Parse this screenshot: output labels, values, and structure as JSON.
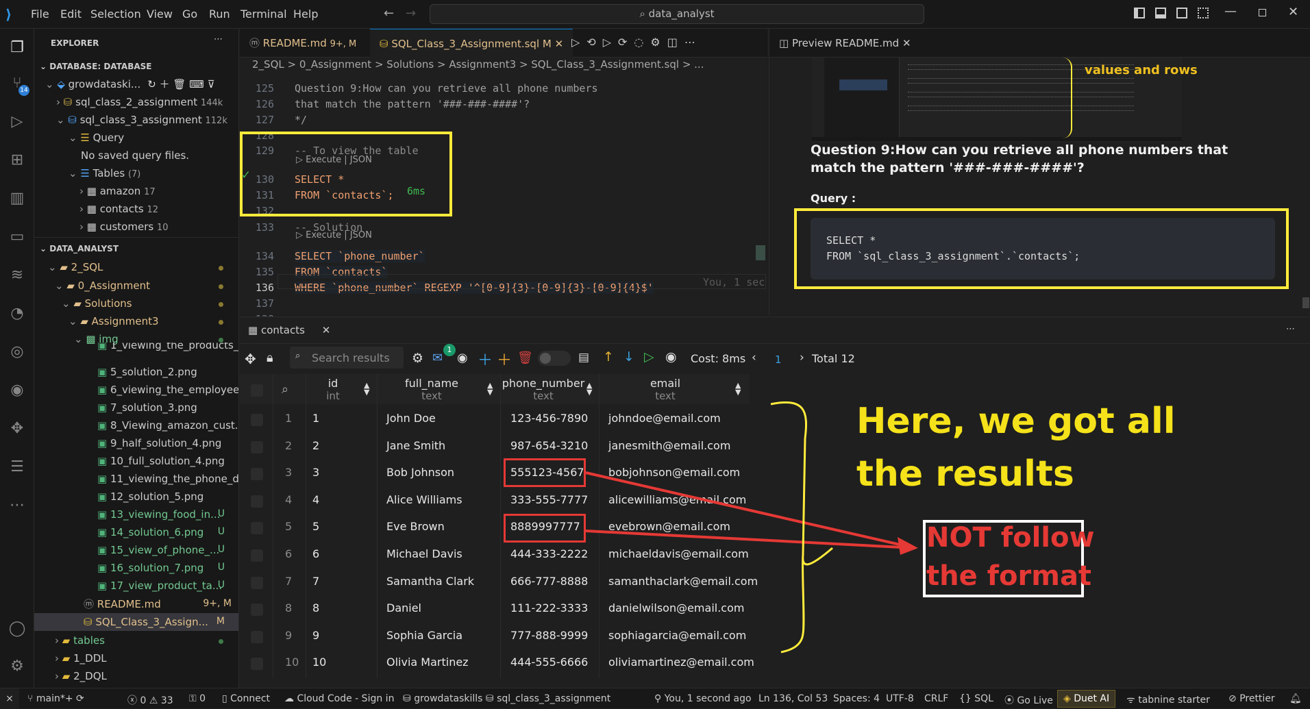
{
  "window": {
    "search": "data_analyst"
  },
  "menu": [
    "File",
    "Edit",
    "Selection",
    "View",
    "Go",
    "Run",
    "Terminal",
    "Help"
  ],
  "explorer": {
    "title": "EXPLORER",
    "db_section": "DATABASE: DATABASE",
    "db_root": "growdataski...",
    "db_items": [
      {
        "name": "sql_class_2_assignment",
        "size": "144k"
      },
      {
        "name": "sql_class_3_assignment",
        "size": "112k"
      }
    ],
    "query": "Query",
    "no_saved": "No saved query files.",
    "tables_label": "Tables",
    "tables_count": "(7)",
    "tables": [
      {
        "name": "amazon",
        "count": "17"
      },
      {
        "name": "contacts",
        "count": "12"
      },
      {
        "name": "customers",
        "count": "10"
      }
    ],
    "project_section": "DATA_ANALYST",
    "tree": [
      "2_SQL",
      "0_Assignment",
      "Solutions",
      "Assignment3",
      "img"
    ],
    "files": [
      {
        "name": "1_viewing_the_products_...",
        "st": ""
      },
      {
        "name": "5_solution_2.png",
        "st": ""
      },
      {
        "name": "6_viewing_the_employee...",
        "st": ""
      },
      {
        "name": "7_solution_3.png",
        "st": ""
      },
      {
        "name": "8_Viewing_amazon_cust...",
        "st": ""
      },
      {
        "name": "9_half_solution_4.png",
        "st": ""
      },
      {
        "name": "10_full_solution_4.png",
        "st": ""
      },
      {
        "name": "11_viewing_the_phone_d...",
        "st": ""
      },
      {
        "name": "12_solution_5.png",
        "st": ""
      },
      {
        "name": "13_viewing_food_in...",
        "st": "U"
      },
      {
        "name": "14_solution_6.png",
        "st": "U"
      },
      {
        "name": "15_view_of_phone_...",
        "st": "U"
      },
      {
        "name": "16_solution_7.png",
        "st": "U"
      },
      {
        "name": "17_view_product_ta...",
        "st": "U"
      }
    ],
    "readme": "README.md",
    "readme_badge": "9+, M",
    "sqlfile": "SQL_Class_3_Assign...",
    "sqlfile_badge": "M",
    "after": [
      "tables",
      "1_DDL",
      "2_DQL"
    ]
  },
  "editor": {
    "tab1": "README.md",
    "tab1_badge": "9+, M",
    "tab2": "SQL_Class_3_Assignment.sql",
    "tab2_badge": "M",
    "breadcrumb": "2_SQL > 0_Assignment > Solutions > Assignment3 > SQL_Class_3_Assignment.sql > ...",
    "lens": "Execute | JSON",
    "lines": [
      {
        "n": "125",
        "t": "Question 9:How can you retrieve all phone numbers"
      },
      {
        "n": "126",
        "t": "that match the pattern '###-###-####'?"
      },
      {
        "n": "127",
        "t": "*/"
      },
      {
        "n": "128",
        "t": ""
      },
      {
        "n": "129",
        "t": "-- To view the table"
      },
      {
        "n": "130",
        "t": "SELECT *"
      },
      {
        "n": "131",
        "t": "FROM `contacts`;"
      },
      {
        "n": "132",
        "t": ""
      },
      {
        "n": "133",
        "t": "-- Solution"
      },
      {
        "n": "134",
        "t": "SELECT `phone_number`"
      },
      {
        "n": "135",
        "t": "FROM `contacts`"
      },
      {
        "n": "136",
        "t": "WHERE `phone_number` REGEXP '^[0-9]{3}-[0-9]{3}-[0-9]{4}$'"
      },
      {
        "n": "137",
        "t": ""
      },
      {
        "n": "138",
        "t": ""
      }
    ],
    "timing": "6ms",
    "blame": "You, 1 sec"
  },
  "preview": {
    "tab": "Preview README.md",
    "annotation": "values and rows",
    "question": "Question 9:How can you retrieve all phone numbers that match the pattern '###-###-####'?",
    "query_label": "Query :",
    "code1": "SELECT *",
    "code2": "FROM `sql_class_3_assignment`.`contacts`;"
  },
  "results": {
    "tab": "contacts",
    "search_placeholder": "Search results",
    "notif": "1",
    "cost": "Cost: 8ms",
    "page": "1",
    "total": "Total 12",
    "columns": [
      {
        "name": "id",
        "type": "int"
      },
      {
        "name": "full_name",
        "type": "text"
      },
      {
        "name": "phone_number",
        "type": "text"
      },
      {
        "name": "email",
        "type": "text"
      }
    ],
    "rows": [
      [
        "1",
        "1",
        "John Doe",
        "123-456-7890",
        "johndoe@email.com"
      ],
      [
        "2",
        "2",
        "Jane Smith",
        "987-654-3210",
        "janesmith@email.com"
      ],
      [
        "3",
        "3",
        "Bob Johnson",
        "555123-4567",
        "bobjohnson@email.com"
      ],
      [
        "4",
        "4",
        "Alice Williams",
        "333-555-7777",
        "alicewilliams@email.com"
      ],
      [
        "5",
        "5",
        "Eve Brown",
        "8889997777",
        "evebrown@email.com"
      ],
      [
        "6",
        "6",
        "Michael Davis",
        "444-333-2222",
        "michaeldavis@email.com"
      ],
      [
        "7",
        "7",
        "Samantha Clark",
        "666-777-8888",
        "samanthaclark@email.com"
      ],
      [
        "8",
        "8",
        "Daniel",
        "111-222-3333",
        "danielwilson@email.com"
      ],
      [
        "9",
        "9",
        "Sophia Garcia",
        "777-888-9999",
        "sophiagarcia@email.com"
      ],
      [
        "10",
        "10",
        "Olivia Martinez",
        "444-555-6666",
        "oliviamartinez@email.com"
      ]
    ],
    "annot1": "Here, we got all",
    "annot2": "the results",
    "annot3": "NOT follow",
    "annot4": "the format"
  },
  "status": {
    "branch": "main*+",
    "errors": "0",
    "warnings": "33",
    "ports": "0",
    "connect": "Connect",
    "cloud": "Cloud Code - Sign in",
    "db": "growdataskills",
    "dbname": "sql_class_3_assignment",
    "blame": "You, 1 second ago",
    "pos": "Ln 136, Col 53",
    "spaces": "Spaces: 4",
    "enc": "UTF-8",
    "eol": "CRLF",
    "lang": "SQL",
    "golive": "Go Live",
    "duet": "Duet AI",
    "tabnine": "tabnine starter",
    "prettier": "Prettier"
  }
}
